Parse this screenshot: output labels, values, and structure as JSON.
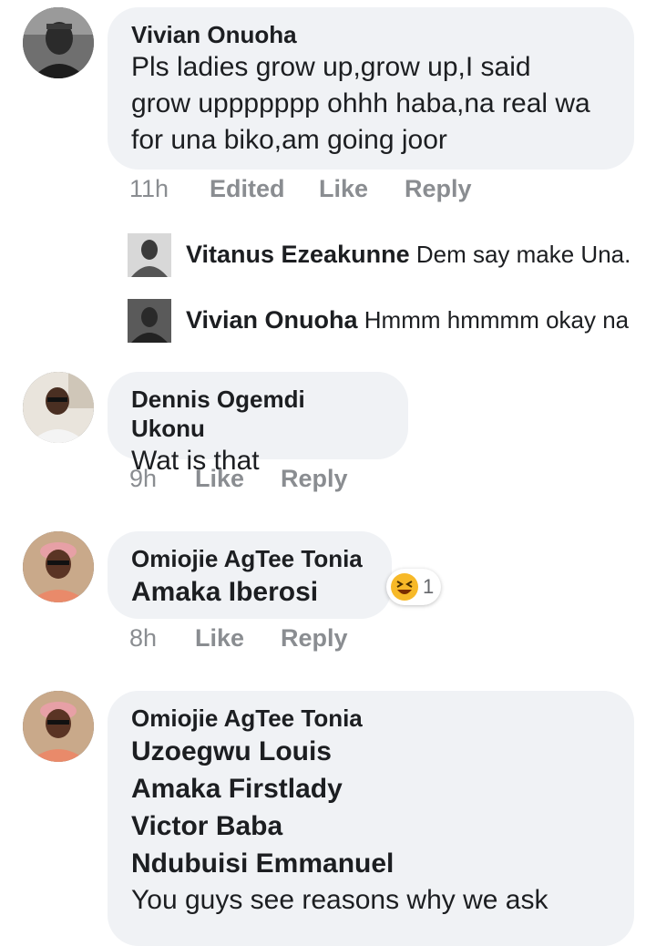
{
  "comments": [
    {
      "author": "Vivian Onuoha",
      "lines": [
        "Pls ladies grow up,grow up,I said",
        "grow uppppppp ohhh haba,na real wa",
        "for una biko,am going joor"
      ],
      "time": "11h",
      "edited": "Edited",
      "like": "Like",
      "reply": "Reply",
      "replies": [
        {
          "author": "Vitanus Ezeakunne",
          "text": "Dem say make Una..."
        },
        {
          "author": "Vivian Onuoha",
          "text": "Hmmm hmmmm okay na"
        }
      ]
    },
    {
      "author": "Dennis Ogemdi Ukonu",
      "text": "Wat is that",
      "time": "9h",
      "like": "Like",
      "reply": "Reply"
    },
    {
      "author": "Omiojie AgTee Tonia",
      "mention": "Amaka Iberosi",
      "reaction_count": "1",
      "reaction_icon": "laughing-emoji-icon",
      "time": "8h",
      "like": "Like",
      "reply": "Reply"
    },
    {
      "author": "Omiojie AgTee Tonia",
      "mentions": [
        "Uzoegwu Louis",
        "Amaka Firstlady",
        "Victor Baba",
        "Ndubuisi Emmanuel"
      ],
      "text": "You guys see reasons why we ask"
    }
  ],
  "colors": {
    "bubble": "#f0f2f5",
    "meta_text": "#8a8d91",
    "reaction_yellow": "#f7b928"
  }
}
